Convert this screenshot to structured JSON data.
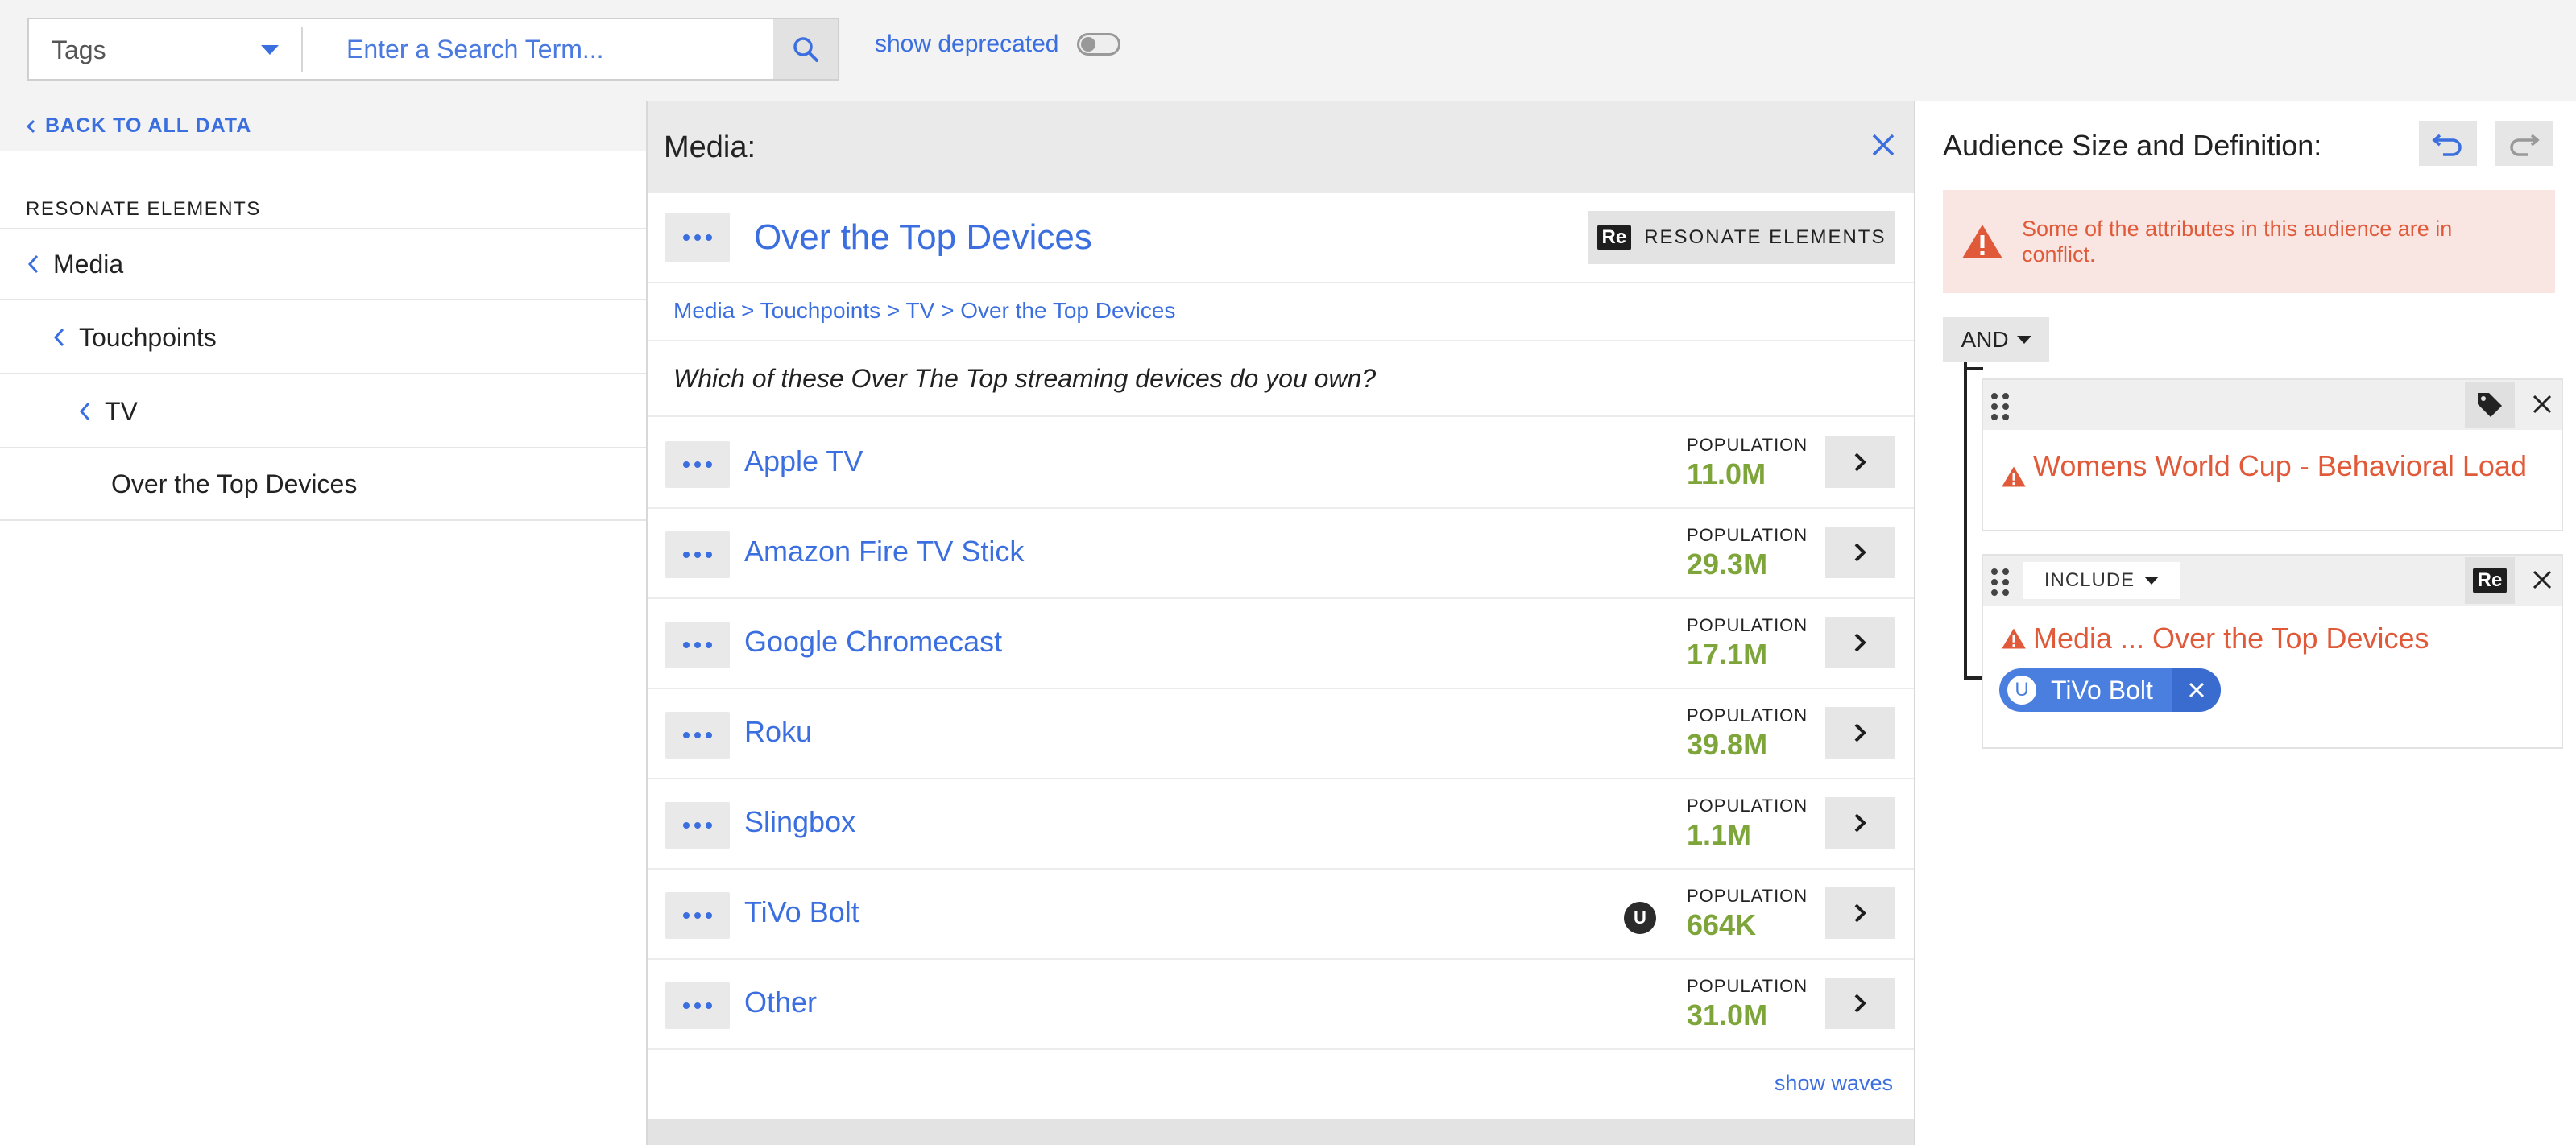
{
  "colors": {
    "accent": "#3b6fe0",
    "population": "#7ea53a",
    "warning": "#e05a3a",
    "warning_bg": "#f9e5e2"
  },
  "search": {
    "filter_label": "Tags",
    "placeholder": "Enter a Search Term...",
    "show_deprecated_label": "show deprecated",
    "show_deprecated": false
  },
  "sidebar": {
    "back_label": "BACK TO ALL DATA",
    "section_title": "RESONATE ELEMENTS",
    "items": [
      {
        "label": "Media"
      },
      {
        "label": "Touchpoints"
      },
      {
        "label": "TV"
      },
      {
        "label": "Over the Top Devices"
      }
    ]
  },
  "media": {
    "panel_title": "Media:",
    "element_title": "Over the Top Devices",
    "resonate_button": "RESONATE ELEMENTS",
    "resonate_logo": "Re",
    "breadcrumb": "Media > Touchpoints > TV > Over the Top Devices",
    "question": "Which of these Over The Top streaming devices do you own?",
    "population_label": "POPULATION",
    "options": [
      {
        "name": "Apple TV",
        "population": "11.0M"
      },
      {
        "name": "Amazon Fire TV Stick",
        "population": "29.3M"
      },
      {
        "name": "Google Chromecast",
        "population": "17.1M"
      },
      {
        "name": "Roku",
        "population": "39.8M"
      },
      {
        "name": "Slingbox",
        "population": "1.1M"
      },
      {
        "name": "TiVo Bolt",
        "population": "664K",
        "badge": "U"
      },
      {
        "name": "Other",
        "population": "31.0M"
      }
    ],
    "show_waves": "show waves"
  },
  "audience": {
    "title": "Audience Size and Definition:",
    "alert": "Some of the attributes in this audience are in conflict.",
    "operator": "AND",
    "rules": [
      {
        "name": "Womens World Cup - Behavioral Load",
        "icon": "tag-icon"
      },
      {
        "mode": "INCLUDE",
        "name": "Media ... Over the Top Devices",
        "logo": "Re",
        "chip": {
          "badge": "U",
          "label": "TiVo Bolt"
        }
      }
    ]
  }
}
